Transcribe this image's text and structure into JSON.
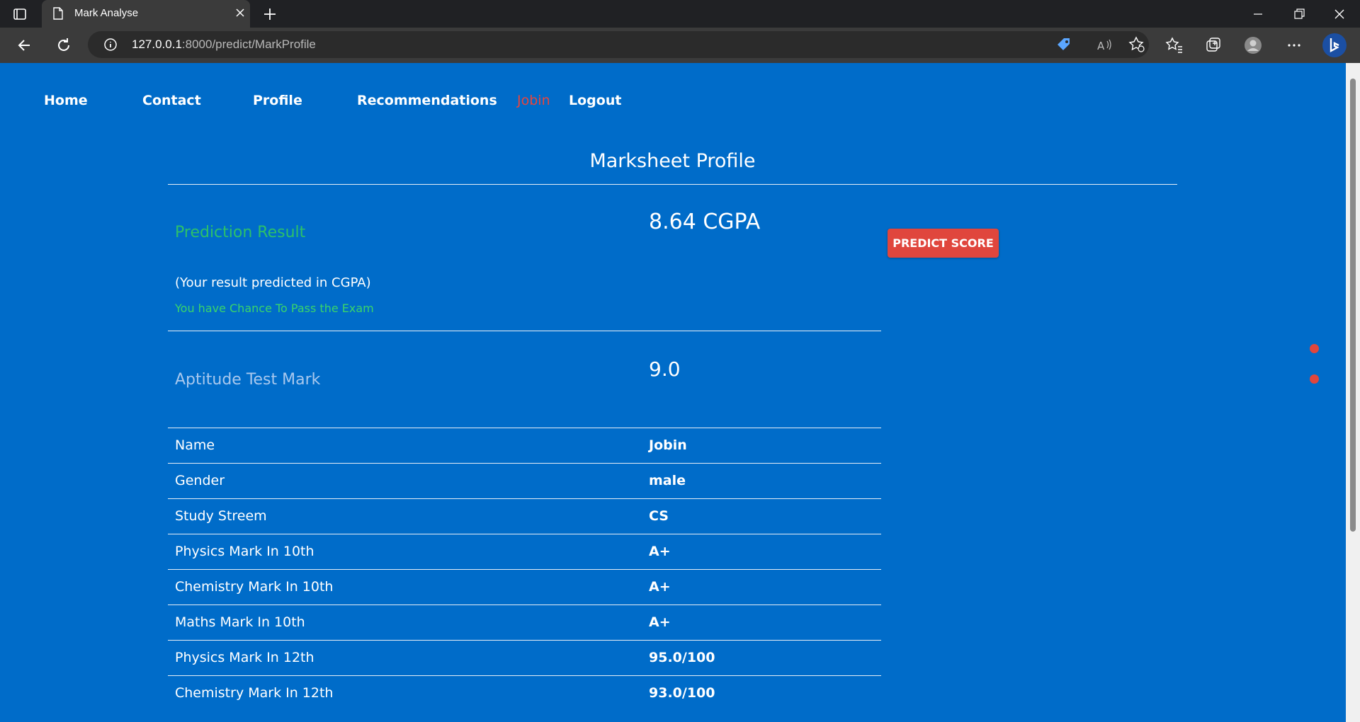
{
  "browser": {
    "tab_title": "Mark Analyse",
    "url_host": "127.0.0.1",
    "url_rest": ":8000/predict/MarkProfile"
  },
  "nav": {
    "items": [
      "Home",
      "Contact",
      "Profile",
      "Recommendations"
    ],
    "user": "Jobin",
    "logout": "Logout"
  },
  "page": {
    "title": "Marksheet Profile",
    "prediction_label": "Prediction Result",
    "prediction_value": "8.64 CGPA",
    "prediction_note": "(Your result predicted in CGPA)",
    "prediction_chance": "You have Chance To Pass the Exam",
    "predict_button": "PREDICT SCORE",
    "aptitude_label": "Aptitude Test Mark",
    "aptitude_value": "9.0"
  },
  "details": [
    {
      "label": "Name",
      "value": "Jobin"
    },
    {
      "label": "Gender",
      "value": "male"
    },
    {
      "label": "Study Streem",
      "value": "CS"
    },
    {
      "label": "Physics Mark In 10th",
      "value": "A+"
    },
    {
      "label": "Chemistry Mark In 10th",
      "value": "A+"
    },
    {
      "label": "Maths Mark In 10th",
      "value": "A+"
    },
    {
      "label": "Physics Mark In 12th",
      "value": "95.0/100"
    },
    {
      "label": "Chemistry Mark In 12th",
      "value": "93.0/100"
    }
  ],
  "colors": {
    "page_bg": "#006cc9",
    "accent_red": "#e0463d",
    "success_green": "#2cc06a"
  }
}
